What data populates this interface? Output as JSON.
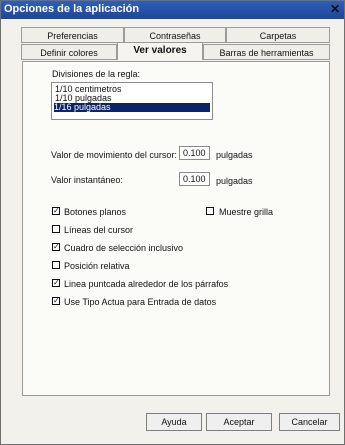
{
  "window": {
    "title": "Opciones de la aplicación",
    "close_glyph": "✕"
  },
  "tabs": {
    "row1": [
      "Preferencias",
      "Contraseñas",
      "Carpetas"
    ],
    "row2": [
      "Definir colores",
      "Ver valores",
      "Barras de herramientas"
    ],
    "active": "Ver valores"
  },
  "panel": {
    "rule_label": "Divisiones de la regla:",
    "rule_options": [
      "1/10 centimetros",
      "1/10 pulgadas",
      "1/16 pulgadas"
    ],
    "rule_selected_index": 2,
    "cursor_move": {
      "label": "Valor de movimiento del cursor:",
      "value": "0.100",
      "unit": "pulgadas"
    },
    "snap": {
      "label": "Valor instantáneo:",
      "value": "0.100",
      "unit": "pulgadas"
    },
    "options": [
      {
        "label": "Botones planos",
        "checked": true
      },
      {
        "label": "Muestre grilla",
        "checked": false
      },
      {
        "label": "Líneas del cursor",
        "checked": false
      },
      {
        "label": "Cuadro de selección inclusivo",
        "checked": true
      },
      {
        "label": "Posición relativa",
        "checked": false
      },
      {
        "label": "Linea puntcada alrededor de los párrafos",
        "checked": true
      },
      {
        "label": "Use Tipo Actua para Entrada de datos",
        "checked": true
      }
    ]
  },
  "buttons": {
    "help": "Ayuda",
    "ok": "Aceptar",
    "cancel": "Cancelar"
  }
}
